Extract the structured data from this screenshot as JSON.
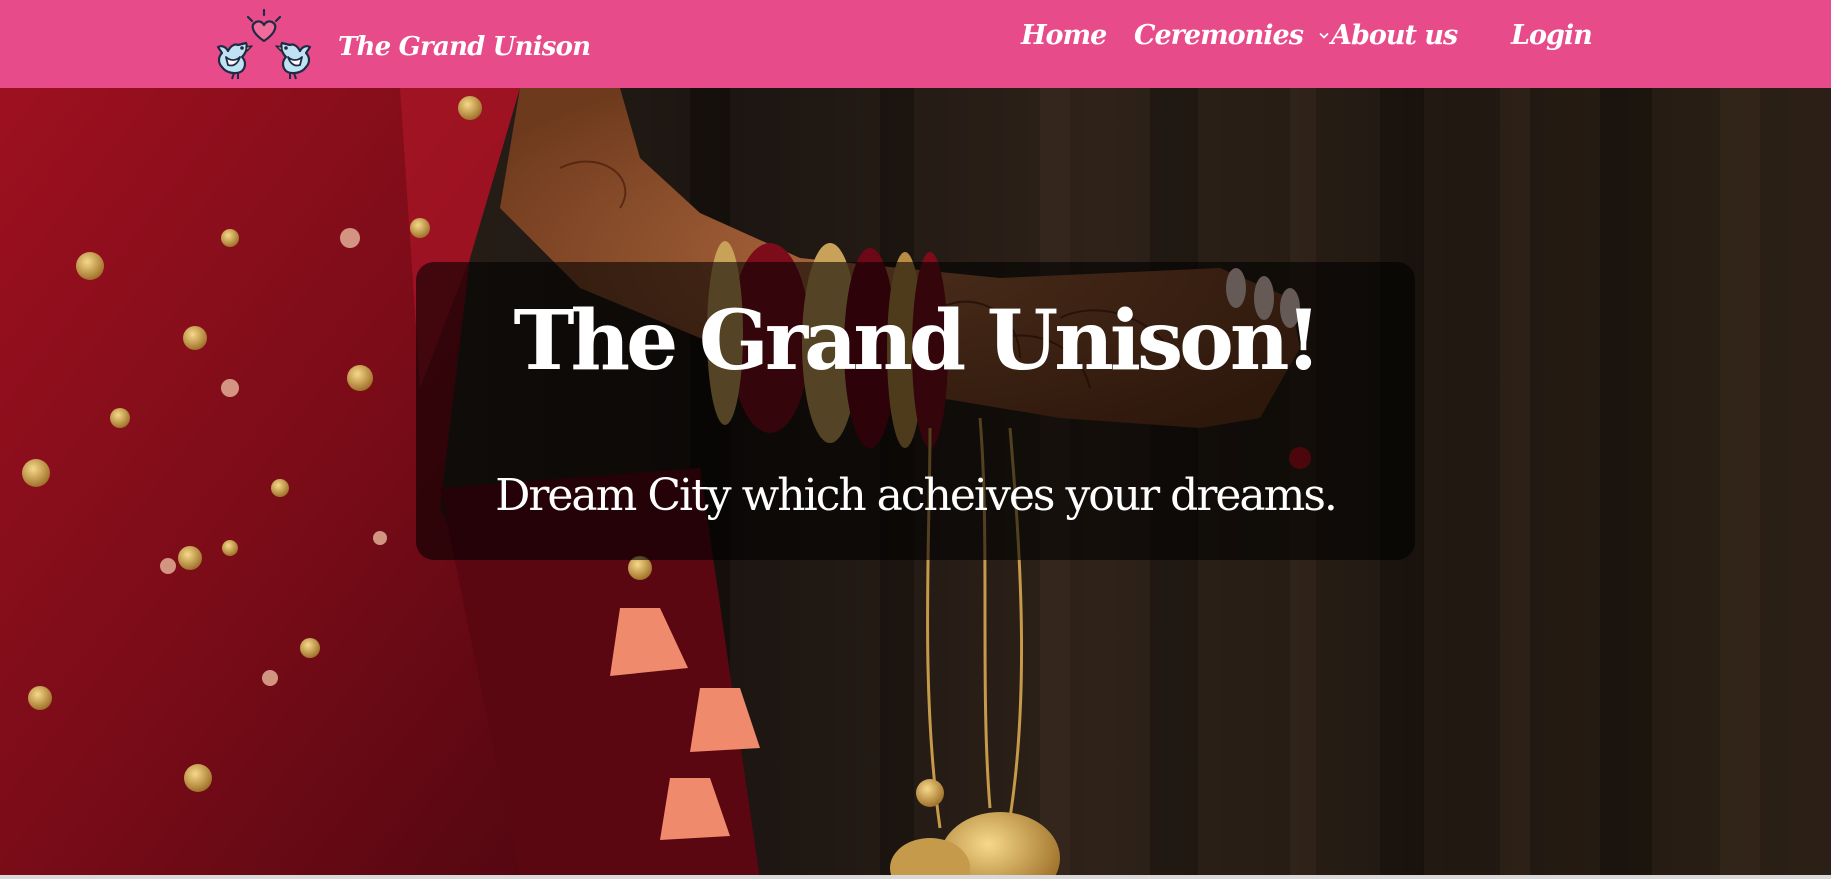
{
  "navbar": {
    "brand_name": "The Grand Unison",
    "logo_icon": "love-birds-heart-icon",
    "links": [
      {
        "label": "Home"
      },
      {
        "label": "Ceremonies",
        "has_dropdown": true
      },
      {
        "label": "About us"
      },
      {
        "label": "Login"
      }
    ],
    "background_color": "#e84b8a"
  },
  "hero": {
    "title": "The Grand Unison!",
    "subtitle": "Dream City which acheives your dreams.",
    "background_image": "bride-with-mehndi-hand-red-lehenga-photo"
  }
}
